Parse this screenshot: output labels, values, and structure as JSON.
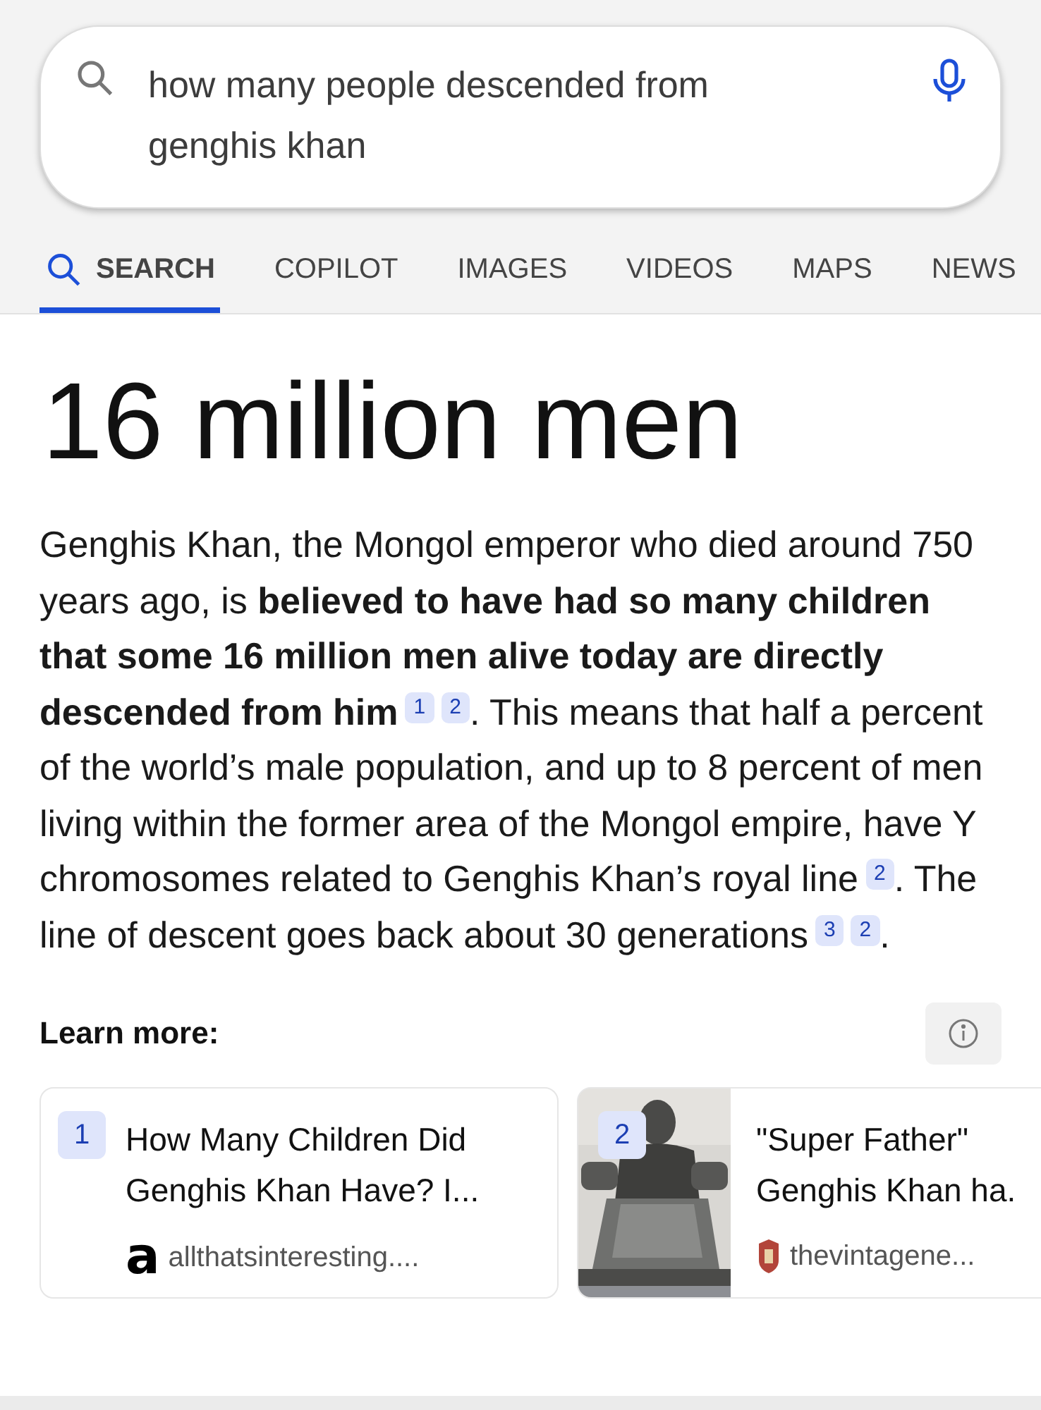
{
  "search": {
    "query": "how many people descended from genghis khan"
  },
  "tabs": [
    {
      "label": "SEARCH",
      "selected": true,
      "kind": "search"
    },
    {
      "label": "COPILOT",
      "selected": false
    },
    {
      "label": "IMAGES",
      "selected": false
    },
    {
      "label": "VIDEOS",
      "selected": false
    },
    {
      "label": "MAPS",
      "selected": false
    },
    {
      "label": "NEWS",
      "selected": false
    }
  ],
  "answer": {
    "title": "16 million men",
    "parts": [
      {
        "kind": "text",
        "text": "Genghis Khan, the Mongol emperor who died around 750 years ago, is **believed to have had so many children that some 16 million men alive today are directly descended from him**"
      },
      {
        "kind": "citation",
        "label": "1"
      },
      {
        "kind": "citation",
        "label": "2"
      },
      {
        "kind": "text",
        "text": ". This means that half a percent of the world’s male population, and up to 8 percent of men living within the former area of the Mongol empire, have Y chromosomes related to Genghis Khan’s royal line"
      },
      {
        "kind": "citation",
        "label": "2"
      },
      {
        "kind": "text",
        "text": ". The line of descent goes back about 30 generations"
      },
      {
        "kind": "citation",
        "label": "3"
      },
      {
        "kind": "citation",
        "label": "2"
      },
      {
        "kind": "text",
        "text": "."
      }
    ]
  },
  "learn_more": {
    "heading": "Learn more:",
    "cards": [
      {
        "number": "1",
        "title": "How Many Children Did Genghis Khan Have? I...",
        "source": "allthatsinteresting....",
        "source_logo": "a",
        "kind": "text"
      },
      {
        "number": "2",
        "title": "\"Super Father\" Genghis Khan ha.",
        "source": "thevintagene...",
        "kind": "picture"
      }
    ]
  }
}
